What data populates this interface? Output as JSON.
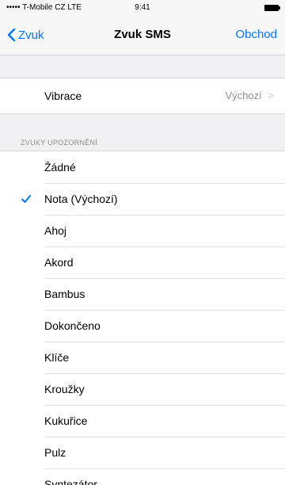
{
  "status_bar": {
    "carrier": "••••• T-Mobile CZ  LTE",
    "time": "9:41"
  },
  "nav": {
    "back_label": "Zvuk",
    "title": "Zvuk SMS",
    "right_label": "Obchod"
  },
  "vibration": {
    "label": "Vibrace",
    "value": "Výchozí",
    "chevron": ">"
  },
  "alert_tones": {
    "header": "ZVUKY UPOZORNĚNÍ",
    "items": [
      {
        "label": "Žádné",
        "selected": false
      },
      {
        "label": "Nota (Výchozí)",
        "selected": true
      },
      {
        "label": "Ahoj",
        "selected": false
      },
      {
        "label": "Akord",
        "selected": false
      },
      {
        "label": "Bambus",
        "selected": false
      },
      {
        "label": "Dokončeno",
        "selected": false
      },
      {
        "label": "Klíče",
        "selected": false
      },
      {
        "label": "Kroužky",
        "selected": false
      },
      {
        "label": "Kukuřice",
        "selected": false
      },
      {
        "label": "Pulz",
        "selected": false
      },
      {
        "label": "Syntezátor",
        "selected": false
      }
    ]
  },
  "colors": {
    "accent": "#007aff",
    "background": "#efeff4",
    "secondary_text": "#8e8e93"
  }
}
